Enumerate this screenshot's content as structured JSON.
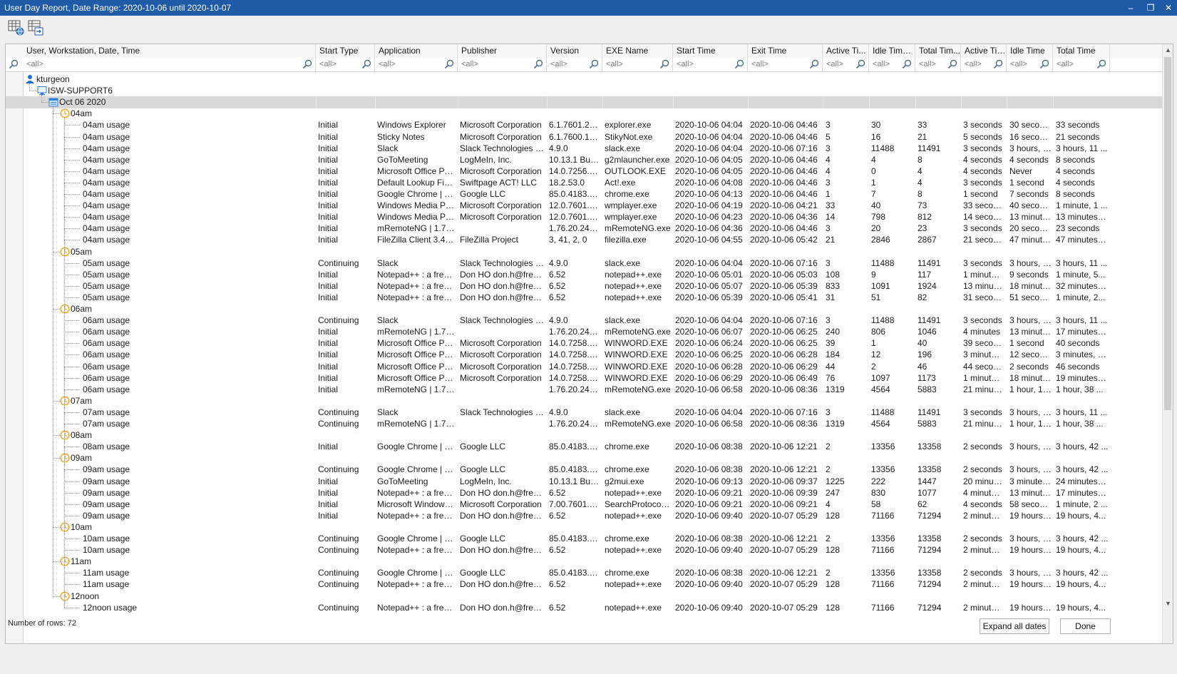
{
  "window": {
    "title": "User Day Report, Date Range: 2020-10-06 until 2020-10-07",
    "minimize_glyph": "–",
    "restore_glyph": "❐",
    "close_glyph": "✕"
  },
  "toolbar": {
    "buttons": [
      {
        "icon": "grid-globe-icon"
      },
      {
        "icon": "export-icon"
      }
    ]
  },
  "columns": [
    {
      "label": "User, Workstation, Date, Time",
      "filter": "<all>"
    },
    {
      "label": "Start Type",
      "filter": "<all>"
    },
    {
      "label": "Application",
      "filter": "<all>"
    },
    {
      "label": "Publisher",
      "filter": "<all>"
    },
    {
      "label": "Version",
      "filter": "<all>"
    },
    {
      "label": "EXE Name",
      "filter": "<all>"
    },
    {
      "label": "Start Time",
      "filter": "<all>"
    },
    {
      "label": "Exit Time",
      "filter": "<all>"
    },
    {
      "label": "Active Ti...",
      "filter": "<all>"
    },
    {
      "label": "Idle Time (...",
      "filter": "<all>"
    },
    {
      "label": "Total Tim...",
      "filter": "<all>"
    },
    {
      "label": "Active Time",
      "filter": "<all>"
    },
    {
      "label": "Idle Time",
      "filter": "<all>"
    },
    {
      "label": "Total Time",
      "filter": "<all>"
    }
  ],
  "rows": [
    {
      "kind": "user",
      "label": "kturgeon",
      "icon": "user-icon"
    },
    {
      "kind": "workstation",
      "label": "ISW-SUPPORT6",
      "icon": "computer-icon"
    },
    {
      "kind": "date",
      "label": "Oct 06 2020",
      "icon": "calendar-icon",
      "selected": true
    },
    {
      "kind": "hour",
      "label": "04am",
      "icon": "clock-icon"
    },
    {
      "kind": "usage",
      "cells": [
        "04am usage",
        "Initial",
        "Windows Explorer",
        "Microsoft Corporation",
        "6.1.7601.234...",
        "explorer.exe",
        "2020-10-06 04:04",
        "2020-10-06 04:46",
        "3",
        "30",
        "33",
        "3 seconds",
        "30 seconds",
        "33 seconds"
      ]
    },
    {
      "kind": "usage",
      "cells": [
        "04am usage",
        "Initial",
        "Sticky Notes",
        "Microsoft Corporation",
        "6.1.7600.163...",
        "StikyNot.exe",
        "2020-10-06 04:04",
        "2020-10-06 04:46",
        "5",
        "16",
        "21",
        "5 seconds",
        "16 seconds",
        "21 seconds"
      ]
    },
    {
      "kind": "usage",
      "cells": [
        "04am usage",
        "Initial",
        "Slack",
        "Slack Technologies Inc.",
        "4.9.0",
        "slack.exe",
        "2020-10-06 04:04",
        "2020-10-06 07:16",
        "3",
        "11488",
        "11491",
        "3 seconds",
        "3 hours, 11 ...",
        "3 hours, 11 ..."
      ]
    },
    {
      "kind": "usage",
      "cells": [
        "04am usage",
        "Initial",
        "GoToMeeting",
        "LogMeIn, Inc.",
        "10.13.1 Build ...",
        "g2mlauncher.exe",
        "2020-10-06 04:05",
        "2020-10-06 04:46",
        "4",
        "4",
        "8",
        "4 seconds",
        "4 seconds",
        "8 seconds"
      ]
    },
    {
      "kind": "usage",
      "cells": [
        "04am usage",
        "Initial",
        "Microsoft Office Profes...",
        "Microsoft Corporation",
        "14.0.7256.5000",
        "OUTLOOK.EXE",
        "2020-10-06 04:05",
        "2020-10-06 04:46",
        "4",
        "0",
        "4",
        "4 seconds",
        "Never",
        "4 seconds"
      ]
    },
    {
      "kind": "usage",
      "cells": [
        "04am usage",
        "Initial",
        "Default Lookup Field f...",
        "Swiftpage ACT! LLC",
        "18.2.53.0",
        "Act!.exe",
        "2020-10-06 04:08",
        "2020-10-06 04:46",
        "3",
        "1",
        "4",
        "3 seconds",
        "1 second",
        "4 seconds"
      ]
    },
    {
      "kind": "usage",
      "cells": [
        "04am usage",
        "Initial",
        "Google Chrome | 85.0....",
        "Google LLC",
        "85.0.4183.121",
        "chrome.exe",
        "2020-10-06 04:13",
        "2020-10-06 04:46",
        "1",
        "7",
        "8",
        "1 second",
        "7 seconds",
        "8 seconds"
      ]
    },
    {
      "kind": "usage",
      "cells": [
        "04am usage",
        "Initial",
        "Windows Media Player",
        "Microsoft Corporation",
        "12.0.7601.23...",
        "wmplayer.exe",
        "2020-10-06 04:19",
        "2020-10-06 04:21",
        "33",
        "40",
        "73",
        "33 seconds",
        "40 seconds",
        "1 minute, 1 ..."
      ]
    },
    {
      "kind": "usage",
      "cells": [
        "04am usage",
        "Initial",
        "Windows Media Player",
        "Microsoft Corporation",
        "12.0.7601.23...",
        "wmplayer.exe",
        "2020-10-06 04:23",
        "2020-10-06 04:36",
        "14",
        "798",
        "812",
        "14 seconds",
        "13 minutes...",
        "13 minutes, ..."
      ]
    },
    {
      "kind": "usage",
      "cells": [
        "04am usage",
        "Initial",
        "mRemoteNG | 1.76.20...",
        "",
        "1.76.20.24615",
        "mRemoteNG.exe",
        "2020-10-06 04:36",
        "2020-10-06 04:46",
        "3",
        "20",
        "23",
        "3 seconds",
        "20 seconds",
        "23 seconds"
      ]
    },
    {
      "kind": "usage",
      "cells": [
        "04am usage",
        "Initial",
        "FileZilla Client 3.41.2 | ...",
        "FileZilla Project",
        "3, 41, 2, 0",
        "filezilla.exe",
        "2020-10-06 04:55",
        "2020-10-06 05:42",
        "21",
        "2846",
        "2867",
        "21 seconds",
        "47 minutes...",
        "47 minutes, ..."
      ]
    },
    {
      "kind": "hour",
      "label": "05am",
      "icon": "clock-icon"
    },
    {
      "kind": "usage",
      "cells": [
        "05am usage",
        "Continuing",
        "Slack",
        "Slack Technologies Inc.",
        "4.9.0",
        "slack.exe",
        "2020-10-06 04:04",
        "2020-10-06 07:16",
        "3",
        "11488",
        "11491",
        "3 seconds",
        "3 hours, 1...",
        "3 hours, 11 ..."
      ]
    },
    {
      "kind": "usage",
      "cells": [
        "05am usage",
        "Initial",
        "Notepad++ : a free (G...",
        "Don HO don.h@free.fr",
        "6.52",
        "notepad++.exe",
        "2020-10-06 05:01",
        "2020-10-06 05:03",
        "108",
        "9",
        "117",
        "1 minute, 4...",
        "9 seconds",
        "1 minute, 5..."
      ]
    },
    {
      "kind": "usage",
      "cells": [
        "05am usage",
        "Initial",
        "Notepad++ : a free (G...",
        "Don HO don.h@free.fr",
        "6.52",
        "notepad++.exe",
        "2020-10-06 05:07",
        "2020-10-06 05:39",
        "833",
        "1091",
        "1924",
        "13 minutes...",
        "18 minutes...",
        "32 minutes, ..."
      ]
    },
    {
      "kind": "usage",
      "cells": [
        "05am usage",
        "Initial",
        "Notepad++ : a free (G...",
        "Don HO don.h@free.fr",
        "6.52",
        "notepad++.exe",
        "2020-10-06 05:39",
        "2020-10-06 05:41",
        "31",
        "51",
        "82",
        "31 seconds",
        "51 seconds",
        "1 minute, 2..."
      ]
    },
    {
      "kind": "hour",
      "label": "06am",
      "icon": "clock-icon"
    },
    {
      "kind": "usage",
      "cells": [
        "06am usage",
        "Continuing",
        "Slack",
        "Slack Technologies Inc.",
        "4.9.0",
        "slack.exe",
        "2020-10-06 04:04",
        "2020-10-06 07:16",
        "3",
        "11488",
        "11491",
        "3 seconds",
        "3 hours, 1...",
        "3 hours, 11 ..."
      ]
    },
    {
      "kind": "usage",
      "cells": [
        "06am usage",
        "Initial",
        "mRemoteNG | 1.76.20...",
        "",
        "1.76.20.24615",
        "mRemoteNG.exe",
        "2020-10-06 06:07",
        "2020-10-06 06:25",
        "240",
        "806",
        "1046",
        "4 minutes",
        "13 minutes...",
        "17 minutes, ..."
      ]
    },
    {
      "kind": "usage",
      "cells": [
        "06am usage",
        "Initial",
        "Microsoft Office Profes...",
        "Microsoft Corporation",
        "14.0.7258.5000",
        "WINWORD.EXE",
        "2020-10-06 06:24",
        "2020-10-06 06:25",
        "39",
        "1",
        "40",
        "39 seconds",
        "1 second",
        "40 seconds"
      ]
    },
    {
      "kind": "usage",
      "cells": [
        "06am usage",
        "Initial",
        "Microsoft Office Profes...",
        "Microsoft Corporation",
        "14.0.7258.5000",
        "WINWORD.EXE",
        "2020-10-06 06:25",
        "2020-10-06 06:28",
        "184",
        "12",
        "196",
        "3 minutes, ...",
        "12 seconds",
        "3 minutes, 1..."
      ]
    },
    {
      "kind": "usage",
      "cells": [
        "06am usage",
        "Initial",
        "Microsoft Office Profes...",
        "Microsoft Corporation",
        "14.0.7258.5000",
        "WINWORD.EXE",
        "2020-10-06 06:28",
        "2020-10-06 06:29",
        "44",
        "2",
        "46",
        "44 seconds",
        "2 seconds",
        "46 seconds"
      ]
    },
    {
      "kind": "usage",
      "cells": [
        "06am usage",
        "Initial",
        "Microsoft Office Profes...",
        "Microsoft Corporation",
        "14.0.7258.5000",
        "WINWORD.EXE",
        "2020-10-06 06:29",
        "2020-10-06 06:49",
        "76",
        "1097",
        "1173",
        "1 minute, 1...",
        "18 minutes...",
        "19 minutes, ..."
      ]
    },
    {
      "kind": "usage",
      "cells": [
        "06am usage",
        "Initial",
        "mRemoteNG | 1.76.20...",
        "",
        "1.76.20.24615",
        "mRemoteNG.exe",
        "2020-10-06 06:58",
        "2020-10-06 08:36",
        "1319",
        "4564",
        "5883",
        "21 minutes...",
        "1 hour, 16 ...",
        "1 hour, 38 ..."
      ]
    },
    {
      "kind": "hour",
      "label": "07am",
      "icon": "clock-icon"
    },
    {
      "kind": "usage",
      "cells": [
        "07am usage",
        "Continuing",
        "Slack",
        "Slack Technologies Inc.",
        "4.9.0",
        "slack.exe",
        "2020-10-06 04:04",
        "2020-10-06 07:16",
        "3",
        "11488",
        "11491",
        "3 seconds",
        "3 hours, 1...",
        "3 hours, 11 ..."
      ]
    },
    {
      "kind": "usage",
      "cells": [
        "07am usage",
        "Continuing",
        "mRemoteNG | 1.76.20...",
        "",
        "1.76.20.24615",
        "mRemoteNG.exe",
        "2020-10-06 06:58",
        "2020-10-06 08:36",
        "1319",
        "4564",
        "5883",
        "21 minutes...",
        "1 hour, 16 ...",
        "1 hour, 38 ..."
      ]
    },
    {
      "kind": "hour",
      "label": "08am",
      "icon": "clock-icon"
    },
    {
      "kind": "usage",
      "cells": [
        "08am usage",
        "Initial",
        "Google Chrome | 85.0....",
        "Google LLC",
        "85.0.4183.121",
        "chrome.exe",
        "2020-10-06 08:38",
        "2020-10-06 12:21",
        "2",
        "13356",
        "13358",
        "2 seconds",
        "3 hours, 4...",
        "3 hours, 42 ..."
      ]
    },
    {
      "kind": "hour",
      "label": "09am",
      "icon": "clock-icon"
    },
    {
      "kind": "usage",
      "cells": [
        "09am usage",
        "Continuing",
        "Google Chrome | 85.0....",
        "Google LLC",
        "85.0.4183.121",
        "chrome.exe",
        "2020-10-06 08:38",
        "2020-10-06 12:21",
        "2",
        "13356",
        "13358",
        "2 seconds",
        "3 hours, 4...",
        "3 hours, 42 ..."
      ]
    },
    {
      "kind": "usage",
      "cells": [
        "09am usage",
        "Initial",
        "GoToMeeting",
        "LogMeIn, Inc.",
        "10.13.1 Build ...",
        "g2mui.exe",
        "2020-10-06 09:13",
        "2020-10-06 09:37",
        "1225",
        "222",
        "1447",
        "20 minutes...",
        "3 minutes, ...",
        "24 minutes, ..."
      ]
    },
    {
      "kind": "usage",
      "cells": [
        "09am usage",
        "Initial",
        "Notepad++ : a free (G...",
        "Don HO don.h@free.fr",
        "6.52",
        "notepad++.exe",
        "2020-10-06 09:21",
        "2020-10-06 09:39",
        "247",
        "830",
        "1077",
        "4 minutes, ...",
        "13 minutes...",
        "17 minutes, ..."
      ]
    },
    {
      "kind": "usage",
      "cells": [
        "09am usage",
        "Initial",
        "Microsoft Windows Se...",
        "Microsoft Corporation",
        "7.00.7601.24...",
        "SearchProtocolHo...",
        "2020-10-06 09:21",
        "2020-10-06 09:21",
        "4",
        "58",
        "62",
        "4 seconds",
        "58 seconds",
        "1 minute, 2 ..."
      ]
    },
    {
      "kind": "usage",
      "cells": [
        "09am usage",
        "Initial",
        "Notepad++ : a free (G...",
        "Don HO don.h@free.fr",
        "6.52",
        "notepad++.exe",
        "2020-10-06 09:40",
        "2020-10-07 05:29",
        "128",
        "71166",
        "71294",
        "2 minutes, ...",
        "19 hours, ...",
        "19 hours, 4..."
      ]
    },
    {
      "kind": "hour",
      "label": "10am",
      "icon": "clock-icon"
    },
    {
      "kind": "usage",
      "cells": [
        "10am usage",
        "Continuing",
        "Google Chrome | 85.0....",
        "Google LLC",
        "85.0.4183.121",
        "chrome.exe",
        "2020-10-06 08:38",
        "2020-10-06 12:21",
        "2",
        "13356",
        "13358",
        "2 seconds",
        "3 hours, 4...",
        "3 hours, 42 ..."
      ]
    },
    {
      "kind": "usage",
      "cells": [
        "10am usage",
        "Continuing",
        "Notepad++ : a free (G...",
        "Don HO don.h@free.fr",
        "6.52",
        "notepad++.exe",
        "2020-10-06 09:40",
        "2020-10-07 05:29",
        "128",
        "71166",
        "71294",
        "2 minutes, ...",
        "19 hours, ...",
        "19 hours, 4..."
      ]
    },
    {
      "kind": "hour",
      "label": "11am",
      "icon": "clock-icon"
    },
    {
      "kind": "usage",
      "cells": [
        "11am usage",
        "Continuing",
        "Google Chrome | 85.0....",
        "Google LLC",
        "85.0.4183.121",
        "chrome.exe",
        "2020-10-06 08:38",
        "2020-10-06 12:21",
        "2",
        "13356",
        "13358",
        "2 seconds",
        "3 hours, 4...",
        "3 hours, 42 ..."
      ]
    },
    {
      "kind": "usage",
      "cells": [
        "11am usage",
        "Continuing",
        "Notepad++ : a free (G...",
        "Don HO don.h@free.fr",
        "6.52",
        "notepad++.exe",
        "2020-10-06 09:40",
        "2020-10-07 05:29",
        "128",
        "71166",
        "71294",
        "2 minutes, ...",
        "19 hours, ...",
        "19 hours, 4..."
      ]
    },
    {
      "kind": "hour",
      "label": "12noon",
      "icon": "clock-icon"
    },
    {
      "kind": "usage",
      "cells": [
        "12noon usage",
        "Continuing",
        "Notepad++ : a free (G...",
        "Don HO don.h@free.fr",
        "6.52",
        "notepad++.exe",
        "2020-10-06 09:40",
        "2020-10-07 05:29",
        "128",
        "71166",
        "71294",
        "2 minutes, ...",
        "19 hours, ...",
        "19 hours, 4..."
      ]
    }
  ],
  "status": {
    "row_count_text": "Number of rows: 72"
  },
  "buttons": {
    "expand_all": "Expand all dates",
    "done": "Done"
  },
  "colors": {
    "titlebar": "#1f5aa6",
    "clock": "#f5a623",
    "user": "#1f6fd1",
    "selected_row": "#d9d9d9"
  }
}
